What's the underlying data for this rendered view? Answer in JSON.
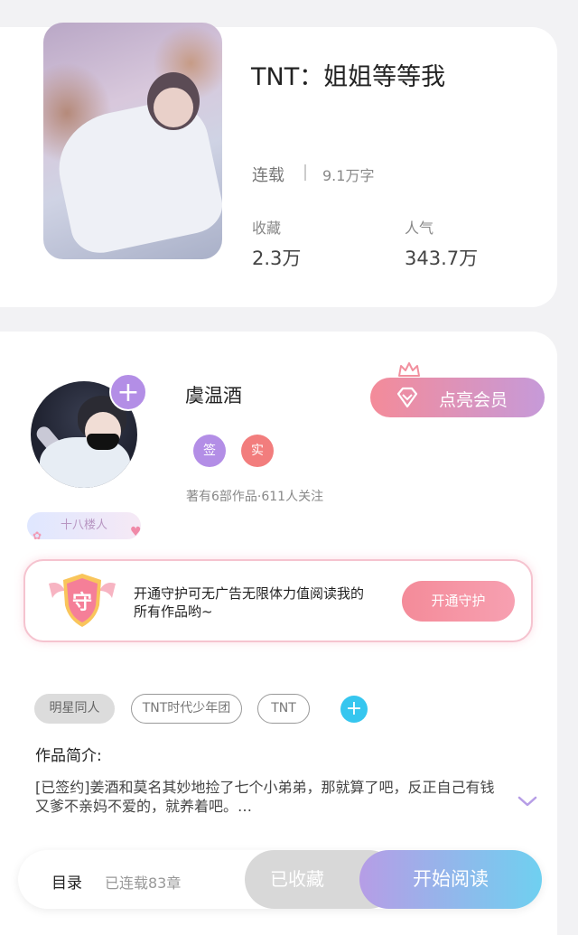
{
  "book": {
    "title": "TNT：姐姐等等我",
    "status": "连载",
    "word_count": "9.1万字",
    "stats": [
      {
        "label": "收藏",
        "value": "2.3万"
      },
      {
        "label": "人气",
        "value": "343.7万"
      }
    ]
  },
  "author": {
    "name": "虞温酒",
    "follow_icon": "+",
    "level_badge": "十八楼人",
    "tags": [
      {
        "label": "签",
        "color": "#b38ee6"
      },
      {
        "label": "实",
        "color": "#f27d7d"
      }
    ],
    "meta": "著有6部作品·611人关注",
    "vip_button": "点亮会员"
  },
  "guard": {
    "icon_char": "守",
    "text": "开通守护可无广告无限体力值阅读我的所有作品哟~",
    "button": "开通守护"
  },
  "genre_tags": [
    "明星同人",
    "TNT时代少年团",
    "TNT"
  ],
  "genre_add_icon": "+",
  "intro": {
    "label": "作品简介:",
    "text": "[已签约]姜酒和莫名其妙地捡了七个小弟弟，那就算了吧，反正自己有钱又爹不亲妈不爱的，就养着吧。…"
  },
  "bottom_bar": {
    "toc_label": "目录",
    "chapters": "已连载83章",
    "favorite_button": "已收藏",
    "read_button": "开始阅读"
  },
  "colors": {
    "accent_purple": "#b38ee6",
    "accent_blue": "#6fd0f0",
    "accent_pink": "#f48b99"
  }
}
